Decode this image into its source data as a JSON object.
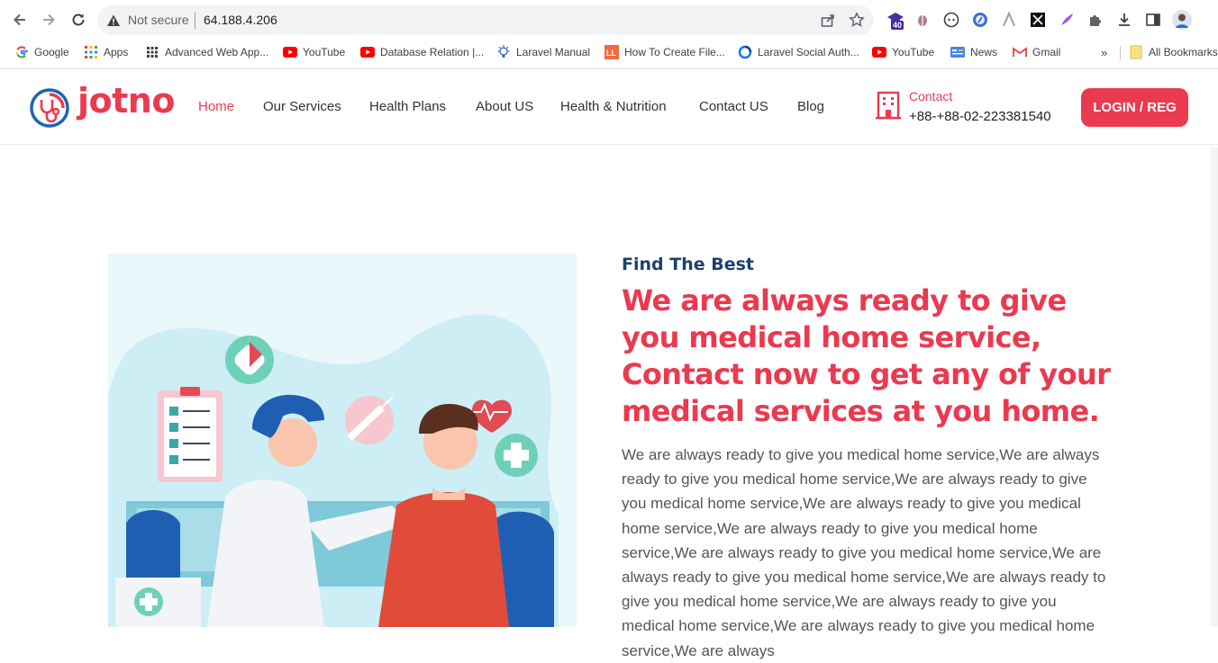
{
  "browser": {
    "security_label": "Not secure",
    "url": "64.188.4.206",
    "extension_badge": "40",
    "bookmarks": [
      {
        "label": "Google",
        "icon": "google-icon"
      },
      {
        "label": "Apps",
        "icon": "apps-grid-icon"
      },
      {
        "label": "Advanced Web App...",
        "icon": "grid-icon"
      },
      {
        "label": "YouTube",
        "icon": "youtube-icon"
      },
      {
        "label": "Database Relation |...",
        "icon": "youtube-icon"
      },
      {
        "label": "Laravel Manual",
        "icon": "bulb-icon"
      },
      {
        "label": "How To Create File...",
        "icon": "ll-icon"
      },
      {
        "label": "Laravel Social Auth...",
        "icon": "loop-icon"
      },
      {
        "label": "YouTube",
        "icon": "youtube-icon"
      },
      {
        "label": "News",
        "icon": "news-icon"
      },
      {
        "label": "Gmail",
        "icon": "gmail-icon"
      }
    ],
    "more_bookmarks": "»",
    "all_bookmarks": "All Bookmarks"
  },
  "site": {
    "logo_text": "jotno",
    "nav": [
      {
        "label": "Home",
        "active": true
      },
      {
        "label": "Our Services",
        "active": false
      },
      {
        "label": "Health Plans",
        "active": false
      },
      {
        "label": "About US",
        "active": false
      },
      {
        "label": "Health & Nutrition",
        "active": false
      },
      {
        "label": "Contact US",
        "active": false
      },
      {
        "label": "Blog",
        "active": false
      }
    ],
    "contact_label": "Contact",
    "contact_phone": "+88-+88-02-223381540",
    "login_label": "LOGIN / REG"
  },
  "hero": {
    "subtitle": "Find The Best",
    "title": "We are always ready to give you medical home service, Contact now to get any of your medical services at you home.",
    "body": "We are always ready to give you medical home service,We are always ready to give you medical home service,We are always ready to give you medical home service,We are always ready to give you medical home service,We are always ready to give you medical home service,We are always ready to give you medical home service,We are always ready to give you medical home service,We are always ready to give you medical home service,We are always ready to give you medical home service,We are always ready to give you medical home service,We are always"
  },
  "colors": {
    "brand_red": "#ea3a50",
    "navy": "#1d3f6e",
    "text_gray": "#555555"
  }
}
